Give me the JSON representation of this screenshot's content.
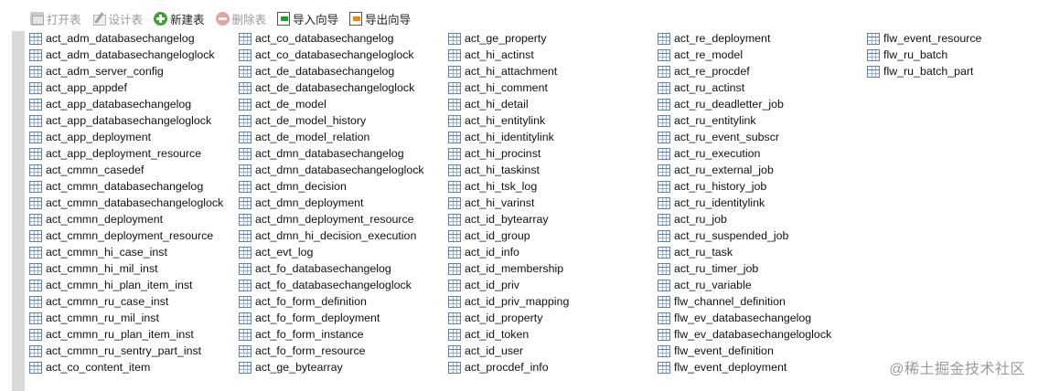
{
  "toolbar": {
    "buttons": [
      {
        "label": "打开表",
        "icon": "open-table-icon",
        "enabled": false
      },
      {
        "label": "设计表",
        "icon": "design-table-icon",
        "enabled": false
      },
      {
        "label": "新建表",
        "icon": "new-table-icon",
        "enabled": true
      },
      {
        "label": "删除表",
        "icon": "delete-table-icon",
        "enabled": false
      },
      {
        "label": "导入向导",
        "icon": "import-wizard-icon",
        "enabled": true
      },
      {
        "label": "导出向导",
        "icon": "export-wizard-icon",
        "enabled": true
      }
    ]
  },
  "tables": {
    "columns": [
      [
        "act_adm_databasechangelog",
        "act_adm_databasechangeloglock",
        "act_adm_server_config",
        "act_app_appdef",
        "act_app_databasechangelog",
        "act_app_databasechangeloglock",
        "act_app_deployment",
        "act_app_deployment_resource",
        "act_cmmn_casedef",
        "act_cmmn_databasechangelog",
        "act_cmmn_databasechangeloglock",
        "act_cmmn_deployment",
        "act_cmmn_deployment_resource",
        "act_cmmn_hi_case_inst",
        "act_cmmn_hi_mil_inst",
        "act_cmmn_hi_plan_item_inst",
        "act_cmmn_ru_case_inst",
        "act_cmmn_ru_mil_inst",
        "act_cmmn_ru_plan_item_inst",
        "act_cmmn_ru_sentry_part_inst",
        "act_co_content_item"
      ],
      [
        "act_co_databasechangelog",
        "act_co_databasechangeloglock",
        "act_de_databasechangelog",
        "act_de_databasechangeloglock",
        "act_de_model",
        "act_de_model_history",
        "act_de_model_relation",
        "act_dmn_databasechangelog",
        "act_dmn_databasechangeloglock",
        "act_dmn_decision",
        "act_dmn_deployment",
        "act_dmn_deployment_resource",
        "act_dmn_hi_decision_execution",
        "act_evt_log",
        "act_fo_databasechangelog",
        "act_fo_databasechangeloglock",
        "act_fo_form_definition",
        "act_fo_form_deployment",
        "act_fo_form_instance",
        "act_fo_form_resource",
        "act_ge_bytearray"
      ],
      [
        "act_ge_property",
        "act_hi_actinst",
        "act_hi_attachment",
        "act_hi_comment",
        "act_hi_detail",
        "act_hi_entitylink",
        "act_hi_identitylink",
        "act_hi_procinst",
        "act_hi_taskinst",
        "act_hi_tsk_log",
        "act_hi_varinst",
        "act_id_bytearray",
        "act_id_group",
        "act_id_info",
        "act_id_membership",
        "act_id_priv",
        "act_id_priv_mapping",
        "act_id_property",
        "act_id_token",
        "act_id_user",
        "act_procdef_info"
      ],
      [
        "act_re_deployment",
        "act_re_model",
        "act_re_procdef",
        "act_ru_actinst",
        "act_ru_deadletter_job",
        "act_ru_entitylink",
        "act_ru_event_subscr",
        "act_ru_execution",
        "act_ru_external_job",
        "act_ru_history_job",
        "act_ru_identitylink",
        "act_ru_job",
        "act_ru_suspended_job",
        "act_ru_task",
        "act_ru_timer_job",
        "act_ru_variable",
        "flw_channel_definition",
        "flw_ev_databasechangelog",
        "flw_ev_databasechangeloglock",
        "flw_event_definition",
        "flw_event_deployment"
      ],
      [
        "flw_event_resource",
        "flw_ru_batch",
        "flw_ru_batch_part"
      ]
    ]
  },
  "watermark": "@稀土掘金技术社区"
}
